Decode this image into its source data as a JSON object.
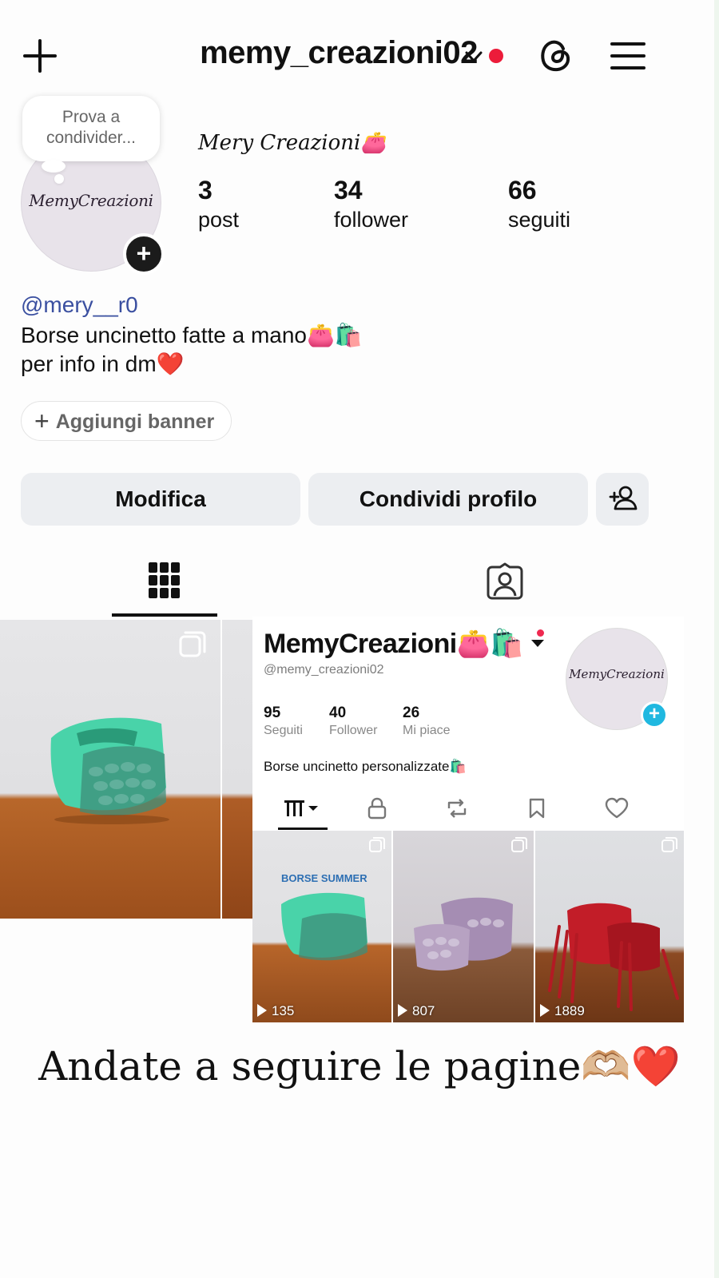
{
  "header": {
    "username": "memy_creazioni02",
    "icons": {
      "new": "plus-icon",
      "switch": "chevron-down-icon",
      "threads": "threads-icon",
      "menu": "hamburger-menu-icon"
    },
    "notification_dot_color": "#ec1c3a"
  },
  "profile": {
    "note_line1": "Prova a",
    "note_line2": "condivider...",
    "avatar_text": "MemyCreazioni",
    "display_name": "Mery Creazioni👛",
    "stats": [
      {
        "value": "3",
        "label": "post"
      },
      {
        "value": "34",
        "label": "follower"
      },
      {
        "value": "66",
        "label": "seguiti"
      }
    ],
    "linked_handle": "@mery__r0",
    "bio": "Borse uncinetto fatte a mano👛🛍️\nper info in dm❤️",
    "banner_button": "Aggiungi banner",
    "edit_button": "Modifica",
    "share_button": "Condividi profilo"
  },
  "tabs": {
    "grid_icon": "grid-icon",
    "tagged_icon": "tagged-person-icon"
  },
  "embedded_profile": {
    "name": "MemyCreazioni👛🛍️",
    "handle": "@memy_creazioni02",
    "avatar_text": "MemyCreazioni",
    "stats": [
      {
        "value": "95",
        "label": "Seguiti"
      },
      {
        "value": "40",
        "label": "Follower"
      },
      {
        "value": "26",
        "label": "Mi piace"
      }
    ],
    "bio": "Borse uncinetto personalizzate🛍️",
    "videos": [
      {
        "views": "135",
        "overlay": "BORSE SUMMER"
      },
      {
        "views": "807"
      },
      {
        "views": "1889"
      }
    ],
    "accent_color": "#20b8e0"
  },
  "caption": "Andate a seguire le pagine🫶🏼❤️"
}
